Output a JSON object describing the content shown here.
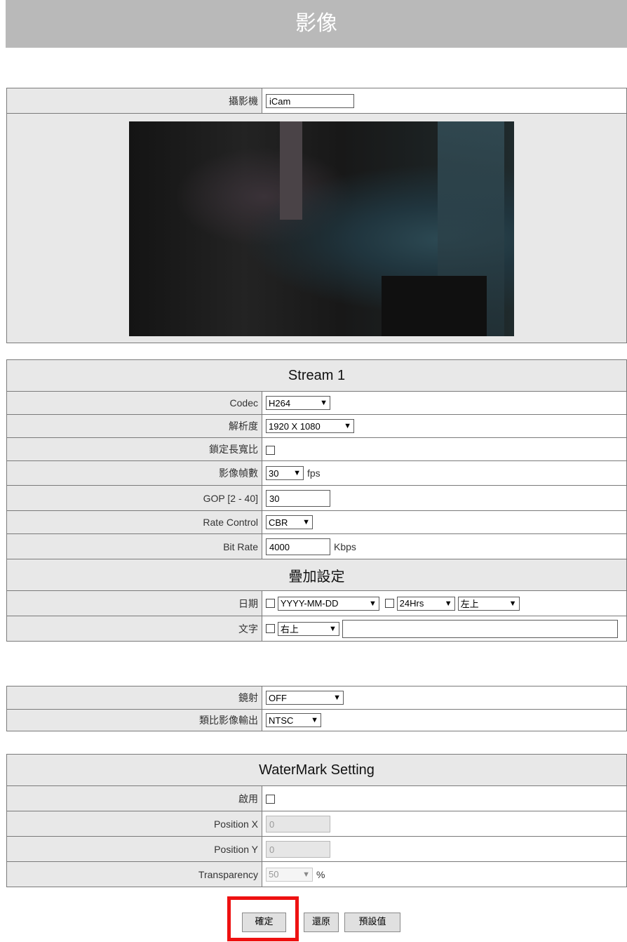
{
  "header": {
    "title": "影像"
  },
  "camera": {
    "label": "攝影機",
    "name_value": "iCam"
  },
  "stream": {
    "title": "Stream 1",
    "codec": {
      "label": "Codec",
      "value": "H264"
    },
    "resolution": {
      "label": "解析度",
      "value": "1920 X 1080"
    },
    "lock_ratio": {
      "label": "鎖定長寬比"
    },
    "fps": {
      "label": "影像幀數",
      "value": "30",
      "unit": "fps"
    },
    "gop": {
      "label": "GOP [2 - 40]",
      "value": "30"
    },
    "rate_control": {
      "label": "Rate Control",
      "value": "CBR"
    },
    "bit_rate": {
      "label": "Bit Rate",
      "value": "4000",
      "unit": "Kbps"
    }
  },
  "overlay": {
    "title": "疊加設定",
    "date": {
      "label": "日期",
      "format_value": "YYYY-MM-DD",
      "hour_value": "24Hrs",
      "position_value": "左上"
    },
    "text": {
      "label": "文字",
      "position_value": "右上",
      "text_value": ""
    }
  },
  "misc": {
    "mirror": {
      "label": "鏡射",
      "value": "OFF"
    },
    "analog": {
      "label": "類比影像輸出",
      "value": "NTSC"
    }
  },
  "watermark": {
    "title": "WaterMark Setting",
    "enable": {
      "label": "啟用"
    },
    "pos_x": {
      "label": "Position X",
      "value": "0"
    },
    "pos_y": {
      "label": "Position Y",
      "value": "0"
    },
    "transparency": {
      "label": "Transparency",
      "value": "50",
      "unit": "%"
    }
  },
  "buttons": {
    "confirm": "確定",
    "restore": "還原",
    "default": "預設值"
  },
  "colors": {
    "header_bg": "#b9b9b9",
    "label_bg": "#e8e8e8",
    "highlight": "#ee1111"
  }
}
